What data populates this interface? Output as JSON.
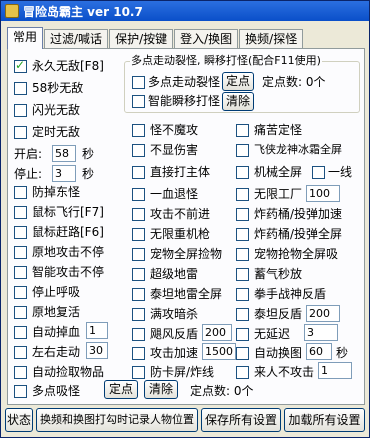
{
  "window": {
    "title": "冒险岛霸主 ver 10.7"
  },
  "tabs": [
    "常用",
    "过滤/喊话",
    "保护/按键",
    "登入/换图",
    "换频/探怪"
  ],
  "col1": {
    "yongjiu": "永久无敌[F8]",
    "wudi58": "58秒无敌",
    "shanguang": "闪光无敌",
    "dingshi": "定时无敌",
    "kaiqi_label": "开启:",
    "kaiqi_value": "58",
    "kaiqi_unit": "秒",
    "tingzhi_label": "停止:",
    "tingzhi_value": "3",
    "tingzhi_unit": "秒",
    "fangzhu": "防掉东怪",
    "shubiao_fly": "鼠标飞行[F7]",
    "shubiao_gan": "鼠标赶路[F6]",
    "yuandi_attack": "原地攻击不停",
    "zhineng_attack": "智能攻击不停",
    "tingzhi_huxi": "停止呼吸",
    "yuandi_revive": "原地复活",
    "auto_drop": "自动掉血",
    "auto_drop_value": "1",
    "zuoyou": "左右走动",
    "zuoyou_value": "30",
    "auto_pick": "自动捡取物品",
    "duodian": "多点吸怪",
    "dingdian_btn": "定点",
    "clear_btn": "清除",
    "dingdian_count": "定点数: 0个"
  },
  "teleport": {
    "group_title": "多点走动裂怪, 瞬移打怪(配合F11使用)",
    "walk": "多点走动裂怪",
    "dingdian_btn": "定点",
    "count": "定点数: 0个",
    "teleport": "智能瞬移打怪",
    "clear_btn": "清除"
  },
  "col2": {
    "guai_bu": "怪不魔攻",
    "bu_hurt": "不显伤害",
    "direct": "直接打主体",
    "yixue": "一血退怪",
    "noforward": "攻击不前进",
    "nogun": "无限重机枪",
    "pet_pick": "宠物全屏捡物",
    "super": "超级地雷",
    "tank": "泰坦地雷全屏",
    "manna": "满攻暗杀",
    "feng_fan": "飓风反盾",
    "feng_value": "200",
    "attack_speed": "攻击加速",
    "attack_value": "1500",
    "fangka": "防卡屏/炸线"
  },
  "col3": {
    "tongku": "痛苦定怪",
    "feixia": "飞侠龙神冰霜全屏",
    "jixie": "机械全屏",
    "yixian": "一线",
    "wuxian": "无限工厂",
    "wuxian_value": "100",
    "zhayao_1": "炸药桶/投弹加速",
    "zhayao_2": "炸药桶/投弹全屏",
    "pet_qp": "宠物抢物全屏吸",
    "xuqi": "蓄气秒放",
    "quanshou": "拳手战神反盾",
    "tt_fan": "泰坦反盾",
    "tt_value": "200",
    "wuyan": "无延迟",
    "wuyan_value": "3",
    "auto_map": "自动换图",
    "auto_map_value": "60",
    "auto_map_unit": "秒",
    "laifangren": "来人不攻击",
    "laifangren_value": "1"
  },
  "bottom": {
    "status": "状态",
    "switch": "换频和换图打勾时记录人物位置",
    "save": "保存所有设置",
    "load": "加载所有设置"
  }
}
